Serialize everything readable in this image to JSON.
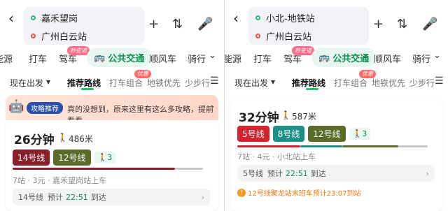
{
  "left": {
    "from": "嘉禾望岗",
    "to": "广州白云站",
    "modes": [
      "能源",
      "打车",
      "驾车",
      "公共交通",
      "顺风车",
      "骑行"
    ],
    "mode_badge": "秒变道",
    "sub_tabs": [
      "现在出发",
      "推荐路线",
      "打车组合",
      "地铁优先",
      "少步行"
    ],
    "sub_badge": "优惠",
    "promo": {
      "badge": "攻略推荐",
      "text": "真的没想到，原来这里有这么多攻略，提前看看"
    },
    "time": "26分钟",
    "walk": "486米",
    "lines": [
      "14号线",
      "12号线"
    ],
    "walk_chip": "3",
    "meta": "7站 · 3元 · 嘉禾望岗站上车",
    "next": {
      "line": "14号线",
      "label": "预计",
      "time": "22:51",
      "suffix": "到达"
    }
  },
  "right": {
    "from": "小北-地铁站",
    "to": "广州白云站",
    "modes": [
      "能源",
      "打车",
      "驾车",
      "公共交通",
      "顺风车",
      "骑行"
    ],
    "mode_badge": "秒变道",
    "sub_tabs": [
      "现在出发",
      "推荐路线",
      "打车组合",
      "地铁优先",
      "少步行"
    ],
    "sub_badge": "优惠",
    "time": "32分钟",
    "walk": "587米",
    "lines": [
      "5号线",
      "8号线",
      "12号线"
    ],
    "walk_chip": "3",
    "meta": "7站 · 4元 · 小北站上车",
    "next": {
      "line": "5号线",
      "label": "预计",
      "time": "22:51",
      "suffix": "到达"
    },
    "warning": "12号线聚龙站末班车预计23:07到站"
  },
  "colors": {
    "green": "#20c26e",
    "line14": "#8a1f2c",
    "line12": "#5c6b2a",
    "line5": "#d5222f",
    "line8": "#1c8f86"
  }
}
